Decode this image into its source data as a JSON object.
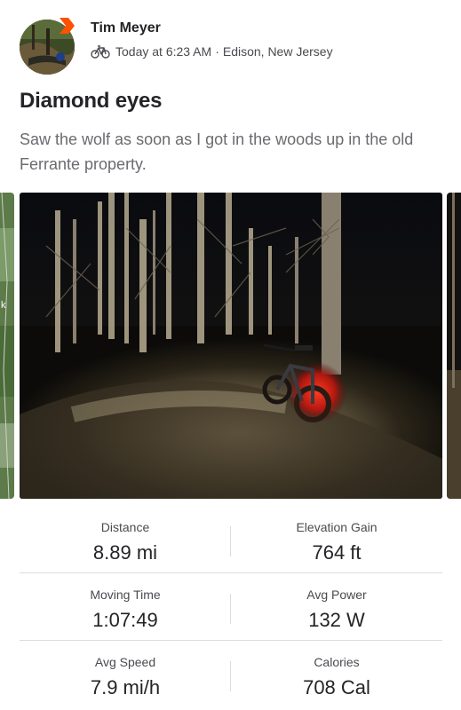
{
  "activity": {
    "athlete_name": "Tim Meyer",
    "timestamp": "Today at 6:23 AM",
    "separator": "·",
    "location": "Edison, New Jersey",
    "sport_icon": "bicycle-icon",
    "title": "Diamond eyes",
    "description": "Saw the wolf as soon as I got in the woods up in the old Ferrante property."
  },
  "media": {
    "map_label_fragment": "k"
  },
  "stats": [
    {
      "left": {
        "label": "Distance",
        "value": "8.89 mi"
      },
      "right": {
        "label": "Elevation Gain",
        "value": "764 ft"
      }
    },
    {
      "left": {
        "label": "Moving Time",
        "value": "1:07:49"
      },
      "right": {
        "label": "Avg Power",
        "value": "132 W"
      }
    },
    {
      "left": {
        "label": "Avg Speed",
        "value": "7.9 mi/h"
      },
      "right": {
        "label": "Calories",
        "value": "708 Cal"
      }
    }
  ],
  "colors": {
    "brand_orange": "#fc5200",
    "text_primary": "#242428",
    "text_secondary": "#6b6b70",
    "divider": "#dcdce0"
  }
}
